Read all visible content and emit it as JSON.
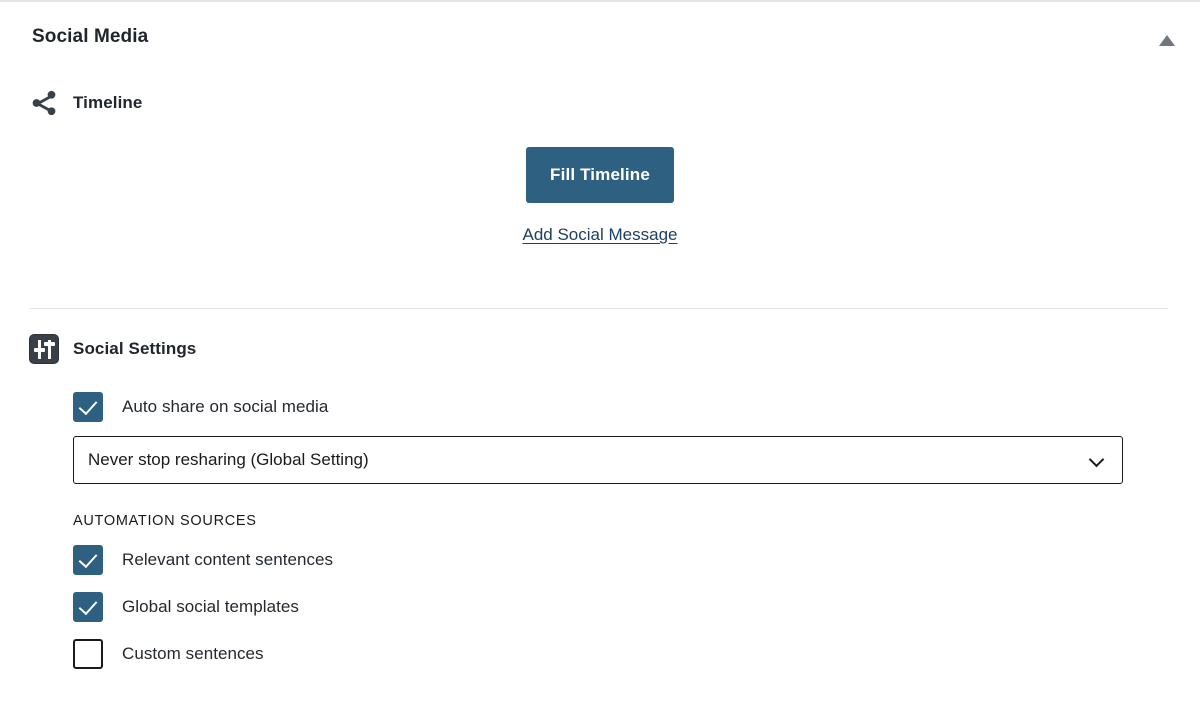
{
  "panel": {
    "title": "Social Media",
    "collapse_icon": "triangle-up-icon",
    "collapse_state": "expanded"
  },
  "timeline_section": {
    "icon": "share-icon",
    "label": "Timeline",
    "fill_button_label": "Fill Timeline",
    "add_link_label": "Add Social Message"
  },
  "settings_section": {
    "icon": "tune-sliders-icon",
    "label": "Social Settings",
    "auto_share": {
      "label": "Auto share on social media",
      "checked": true
    },
    "reshare_select": {
      "value": "Never stop resharing (Global Setting)",
      "chevron_icon": "chevron-down-icon"
    },
    "automation_sources": {
      "label": "Automation Sources",
      "items": [
        {
          "label": "Relevant content sentences",
          "checked": true
        },
        {
          "label": "Global social templates",
          "checked": true
        },
        {
          "label": "Custom sentences",
          "checked": false
        }
      ]
    }
  },
  "colors": {
    "accent": "#2d6081",
    "link": "#1d3f63",
    "heading": "#21262d",
    "divider": "#e2e2e2",
    "icon_box": "#3a4048"
  }
}
